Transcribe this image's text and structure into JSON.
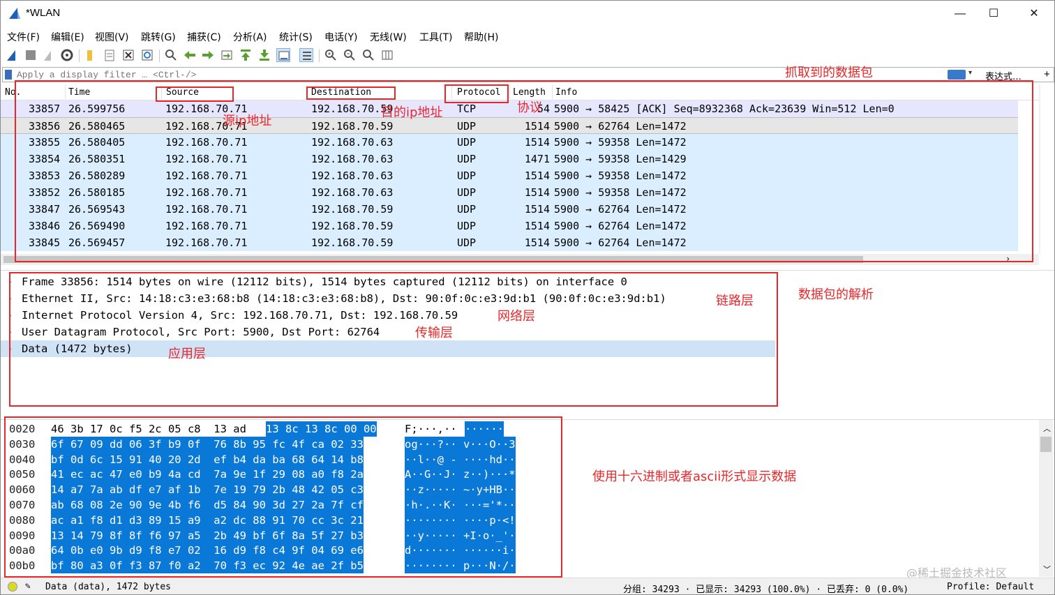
{
  "window": {
    "title": "*WLAN",
    "minimize": "—",
    "maximize": "☐",
    "close": "✕"
  },
  "menu": [
    "文件(F)",
    "编辑(E)",
    "视图(V)",
    "跳转(G)",
    "捕获(C)",
    "分析(A)",
    "统计(S)",
    "电话(Y)",
    "无线(W)",
    "工具(T)",
    "帮助(H)"
  ],
  "filter": {
    "placeholder": "Apply a display filter … <Ctrl-/>",
    "expression_label": "表达式…",
    "add_label": "+"
  },
  "columns": {
    "no": "No.",
    "time": "Time",
    "source": "Source",
    "destination": "Destination",
    "protocol": "Protocol",
    "length": "Length",
    "info": "Info"
  },
  "packets": [
    {
      "no": "33857",
      "time": "26.599756",
      "src": "192.168.70.71",
      "dst": "192.168.70.59",
      "proto": "TCP",
      "len": "54",
      "info": "5900 → 58425 [ACK] Seq=8932368 Ack=23639 Win=512 Len=0"
    },
    {
      "no": "33856",
      "time": "26.580465",
      "src": "192.168.70.71",
      "dst": "192.168.70.59",
      "proto": "UDP",
      "len": "1514",
      "info": "5900 → 62764 Len=1472"
    },
    {
      "no": "33855",
      "time": "26.580405",
      "src": "192.168.70.71",
      "dst": "192.168.70.63",
      "proto": "UDP",
      "len": "1514",
      "info": "5900 → 59358 Len=1472"
    },
    {
      "no": "33854",
      "time": "26.580351",
      "src": "192.168.70.71",
      "dst": "192.168.70.63",
      "proto": "UDP",
      "len": "1471",
      "info": "5900 → 59358 Len=1429"
    },
    {
      "no": "33853",
      "time": "26.580289",
      "src": "192.168.70.71",
      "dst": "192.168.70.63",
      "proto": "UDP",
      "len": "1514",
      "info": "5900 → 59358 Len=1472"
    },
    {
      "no": "33852",
      "time": "26.580185",
      "src": "192.168.70.71",
      "dst": "192.168.70.63",
      "proto": "UDP",
      "len": "1514",
      "info": "5900 → 59358 Len=1472"
    },
    {
      "no": "33847",
      "time": "26.569543",
      "src": "192.168.70.71",
      "dst": "192.168.70.59",
      "proto": "UDP",
      "len": "1514",
      "info": "5900 → 62764 Len=1472"
    },
    {
      "no": "33846",
      "time": "26.569490",
      "src": "192.168.70.71",
      "dst": "192.168.70.59",
      "proto": "UDP",
      "len": "1514",
      "info": "5900 → 62764 Len=1472"
    },
    {
      "no": "33845",
      "time": "26.569457",
      "src": "192.168.70.71",
      "dst": "192.168.70.59",
      "proto": "UDP",
      "len": "1514",
      "info": "5900 → 62764 Len=1472"
    }
  ],
  "details": [
    "Frame 33856: 1514 bytes on wire (12112 bits), 1514 bytes captured (12112 bits) on interface 0",
    "Ethernet II, Src: 14:18:c3:e3:68:b8 (14:18:c3:e3:68:b8), Dst: 90:0f:0c:e3:9d:b1 (90:0f:0c:e3:9d:b1)",
    "Internet Protocol Version 4, Src: 192.168.70.71, Dst: 192.168.70.59",
    "User Datagram Protocol, Src Port: 5900, Dst Port: 62764",
    "Data (1472 bytes)"
  ],
  "bytes": [
    {
      "off": "0020",
      "hex1": "46 3b 17 0c f5 2c 05 c8  13 ad",
      "hex2": "13 8c 13 8c 00 00",
      "ascii1": "F;···,·· ",
      "ascii2": "······"
    },
    {
      "off": "0030",
      "hex1": "",
      "hex2": "6f 67 09 dd 06 3f b9 0f  76 8b 95 fc 4f ca 02 33",
      "ascii1": "",
      "ascii2": "og···?·· v···O··3"
    },
    {
      "off": "0040",
      "hex1": "",
      "hex2": "bf 0d 6c 15 91 40 20 2d  ef b4 da ba 68 64 14 b8",
      "ascii1": "",
      "ascii2": "··l··@ - ····hd··"
    },
    {
      "off": "0050",
      "hex1": "",
      "hex2": "41 ec ac 47 e0 b9 4a cd  7a 9e 1f 29 08 a0 f8 2a",
      "ascii1": "",
      "ascii2": "A··G··J· z··)···*"
    },
    {
      "off": "0060",
      "hex1": "",
      "hex2": "14 a7 7a ab df e7 af 1b  7e 19 79 2b 48 42 05 c3",
      "ascii1": "",
      "ascii2": "··z····· ~·y+HB··"
    },
    {
      "off": "0070",
      "hex1": "",
      "hex2": "ab 68 08 2e 90 9e 4b f6  d5 84 90 3d 27 2a 7f cf",
      "ascii1": "",
      "ascii2": "·h·.··K· ···='*··"
    },
    {
      "off": "0080",
      "hex1": "",
      "hex2": "ac a1 f8 d1 d3 89 15 a9  a2 dc 88 91 70 cc 3c 21",
      "ascii1": "",
      "ascii2": "········ ····p·<!"
    },
    {
      "off": "0090",
      "hex1": "",
      "hex2": "13 14 79 8f 8f f6 97 a5  2b 49 bf 6f 8a 5f 27 b3",
      "ascii1": "",
      "ascii2": "··y····· +I·o·_'·"
    },
    {
      "off": "00a0",
      "hex1": "",
      "hex2": "64 0b e0 9b d9 f8 e7 02  16 d9 f8 c4 9f 04 69 e6",
      "ascii1": "",
      "ascii2": "d······· ······i·"
    },
    {
      "off": "00b0",
      "hex1": "",
      "hex2": "bf 80 a3 0f f3 87 f0 a2  70 f3 ec 92 4e ae 2f b5",
      "ascii1": "",
      "ascii2": "········ p···N·/·"
    }
  ],
  "status": {
    "field": "Data (data), 1472 bytes",
    "packets": "分组: 34293 · 已显示: 34293 (100.0%) · 已丢弃: 0 (0.0%)",
    "profile": "Profile: Default"
  },
  "annotations": {
    "captured": "抓取到的数据包",
    "src_ip": "源ip地址",
    "dst_ip": "目的ip地址",
    "protocol": "协议",
    "link_layer": "链路层",
    "network_layer": "网络层",
    "transport_layer": "传输层",
    "app_layer": "应用层",
    "parse": "数据包的解析",
    "hex_ascii": "使用十六进制或者ascii形式显示数据"
  },
  "watermark": "@稀土掘金技术社区",
  "colors": {
    "udp_row": "#daeeff",
    "tcp_row": "#e7e6ff",
    "selected": "#c8daf0",
    "hex_sel": "#0a78d7",
    "annotation": "#e8272a"
  }
}
